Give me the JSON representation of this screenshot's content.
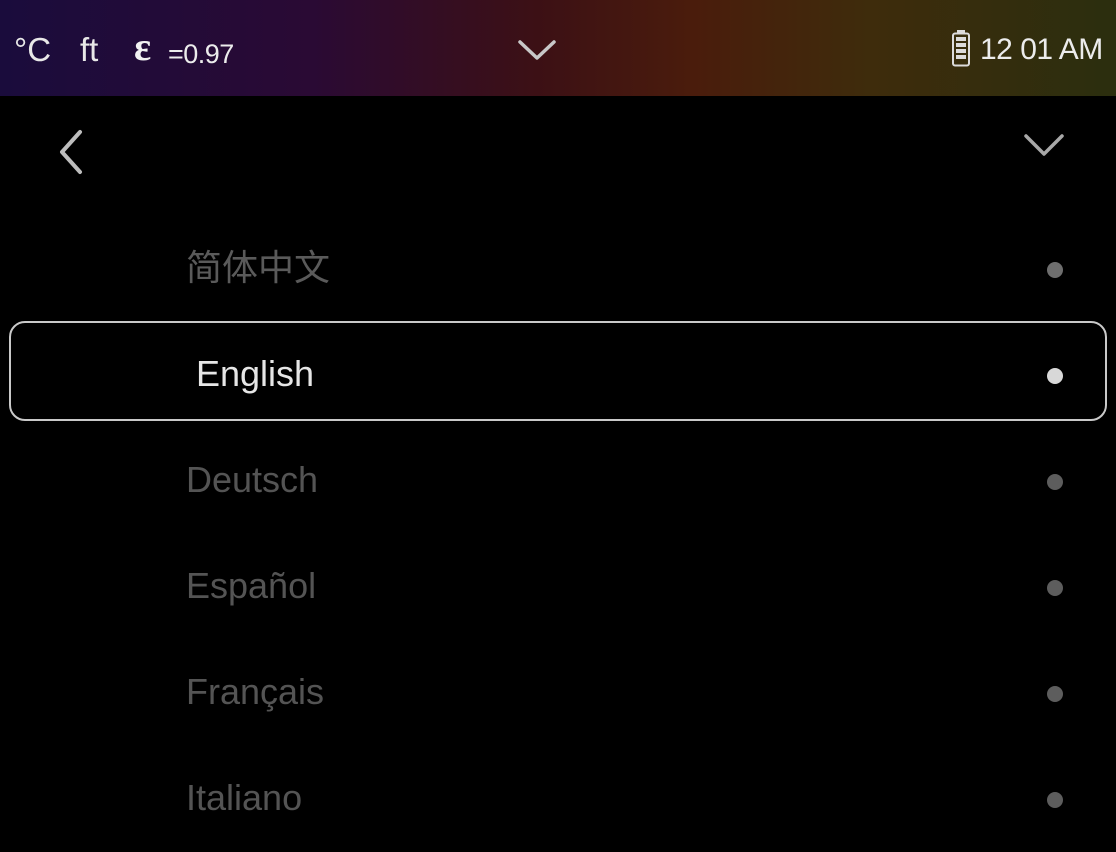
{
  "status_bar": {
    "temp_unit": "°C",
    "distance_unit": "ft",
    "emissivity_symbol": "ε",
    "emissivity_value": "=0.97",
    "chevron_icon": "chevron-down-icon",
    "battery_icon": "battery-icon",
    "time": "12 01 AM"
  },
  "nav": {
    "back_icon": "chevron-left-icon",
    "menu_icon": "chevron-down-icon"
  },
  "languages": [
    {
      "label": "简体中文",
      "selected": false
    },
    {
      "label": "English",
      "selected": true
    },
    {
      "label": "Deutsch",
      "selected": false
    },
    {
      "label": "Español",
      "selected": false
    },
    {
      "label": "Français",
      "selected": false
    },
    {
      "label": "Italiano",
      "selected": false
    }
  ],
  "colors": {
    "background": "#000000",
    "selected_text": "#e6e6e6",
    "unselected_text": "#545454",
    "selection_border": "#c9c9c9"
  }
}
